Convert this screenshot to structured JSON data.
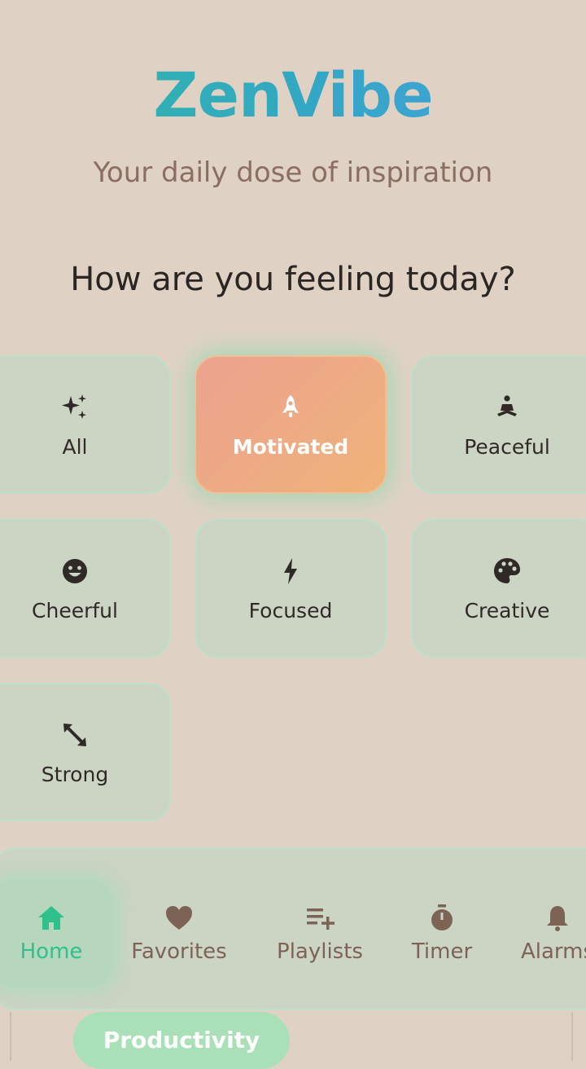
{
  "app": {
    "title": "ZenVibe",
    "tagline": "Your daily dose of inspiration"
  },
  "mood_section": {
    "question": "How are you feeling today?",
    "moods": [
      {
        "label": "All",
        "icon": "sparkles-icon",
        "selected": false
      },
      {
        "label": "Motivated",
        "icon": "rocket-icon",
        "selected": true
      },
      {
        "label": "Peaceful",
        "icon": "meditation-icon",
        "selected": false
      },
      {
        "label": "Cheerful",
        "icon": "smiley-icon",
        "selected": false
      },
      {
        "label": "Focused",
        "icon": "lightning-icon",
        "selected": false
      },
      {
        "label": "Creative",
        "icon": "palette-icon",
        "selected": false
      },
      {
        "label": "Strong",
        "icon": "expand-arrows-icon",
        "selected": false
      }
    ]
  },
  "bottom_nav": {
    "items": [
      {
        "label": "Home",
        "icon": "home-icon",
        "active": true
      },
      {
        "label": "Favorites",
        "icon": "heart-icon",
        "active": false
      },
      {
        "label": "Playlists",
        "icon": "playlist-add-icon",
        "active": false
      },
      {
        "label": "Timer",
        "icon": "stopwatch-icon",
        "active": false
      },
      {
        "label": "Alarms",
        "icon": "bell-icon",
        "active": false
      }
    ]
  },
  "peek": {
    "category_chip": "Productivity"
  },
  "colors": {
    "background": "#dfd2c5",
    "accent_teal": "#2fb8a4",
    "accent_blue": "#4aa0e0",
    "selected_gradient_start": "#eba38f",
    "selected_gradient_end": "#f0b279",
    "nav_active": "#2fc08c",
    "card_bg": "#ccd4c4"
  }
}
